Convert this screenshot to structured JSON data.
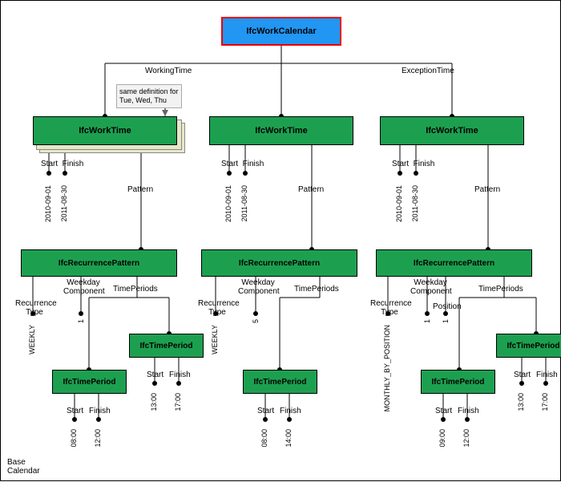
{
  "root": {
    "label": "IfcWorkCalendar"
  },
  "edges": {
    "working": "WorkingTime",
    "exception": "ExceptionTime"
  },
  "note": "same definition for\nTue, Wed, Thu",
  "caption": "Base\nCalendar",
  "worktime": {
    "label": "IfcWorkTime",
    "start": "Start",
    "finish": "Finish",
    "pattern": "Pattern"
  },
  "dates": {
    "c1s": "2010-09-01",
    "c1f": "2011-08-30",
    "c2s": "2010-09-01",
    "c2f": "2011-08-30",
    "c3s": "2010-09-01",
    "c3f": "2011-08-30"
  },
  "rp": "IfcRecurrencePattern",
  "rplbl": {
    "rectype": "Recurrence\nType",
    "weekday": "Weekday\nComponent",
    "timeper": "TimePeriods",
    "position": "Position"
  },
  "rectype": {
    "c1": "WEEKLY",
    "c2": "WEEKLY",
    "c3": "MONTHLY_BY_POSITION"
  },
  "weekday": {
    "c1": "1",
    "c2": "5"
  },
  "position": {
    "c3": "1"
  },
  "tp": "IfcTimePeriod",
  "times": {
    "c1a_s": "08:00",
    "c1a_f": "12:00",
    "c1b_s": "13:00",
    "c1b_f": "17:00",
    "c2_s": "08:00",
    "c2_f": "14:00",
    "c3a_s": "09:00",
    "c3a_f": "12:00",
    "c3b_s": "13:00",
    "c3b_f": "17:00"
  }
}
